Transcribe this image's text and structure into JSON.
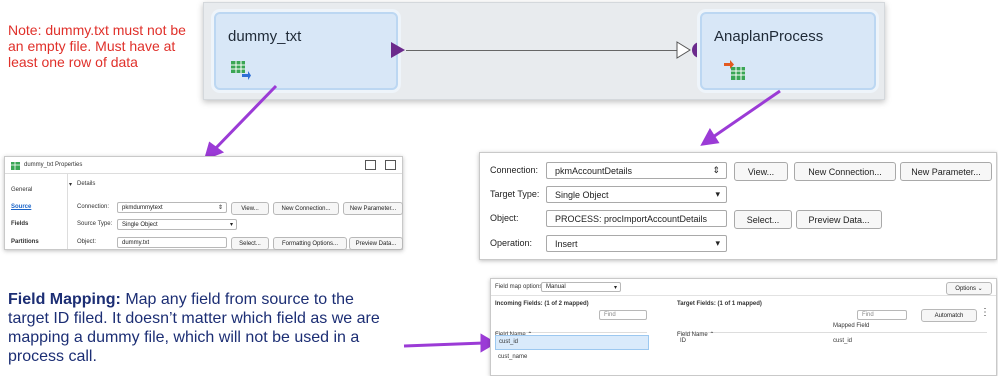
{
  "note": "Note:  dummy.txt must not be an empty file.  Must have at least one row of data",
  "flow": {
    "source_node": "dummy_txt",
    "target_node": "AnaplanProcess"
  },
  "props": {
    "title": "dummy_txt Properties",
    "tabs": [
      "General",
      "Source",
      "Fields",
      "Partitions"
    ],
    "section": "Details",
    "connection_label": "Connection:",
    "connection_value": "pkmdummytext",
    "view": "View...",
    "new_connection": "New Connection...",
    "new_parameter": "New Parameter...",
    "source_type_label": "Source Type:",
    "source_type_value": "Single Object",
    "object_label": "Object:",
    "object_value": "dummy.txt",
    "select": "Select...",
    "formatting": "Formatting Options...",
    "preview": "Preview Data..."
  },
  "target": {
    "connection_label": "Connection:",
    "connection_value": "pkmAccountDetails",
    "view": "View...",
    "new_connection": "New Connection...",
    "new_parameter": "New Parameter...",
    "target_type_label": "Target Type:",
    "target_type_value": "Single Object",
    "object_label": "Object:",
    "object_value": "PROCESS: procImportAccountDetails",
    "select": "Select...",
    "preview": "Preview Data...",
    "operation_label": "Operation:",
    "operation_value": "Insert"
  },
  "mapping": {
    "options_label": "Field map options:",
    "options_value": "Manual",
    "options_button": "Options",
    "incoming_title": "Incoming Fields: (1 of 2 mapped)",
    "target_title": "Target Fields: (1 of 1 mapped)",
    "find": "Find",
    "automatch": "Automatch",
    "field_name_header": "Field Name",
    "mapped_field_header": "Mapped Field",
    "incoming": [
      "cust_id",
      "cust_name"
    ],
    "target_rows": [
      {
        "field": "ID",
        "mapped": "cust_id"
      }
    ]
  },
  "caption": {
    "bold": "Field Mapping:",
    "text": "  Map any field from source to the target ID filed.  It doesn’t matter which field as we are mapping a dummy file, which will not be used in a process call."
  }
}
